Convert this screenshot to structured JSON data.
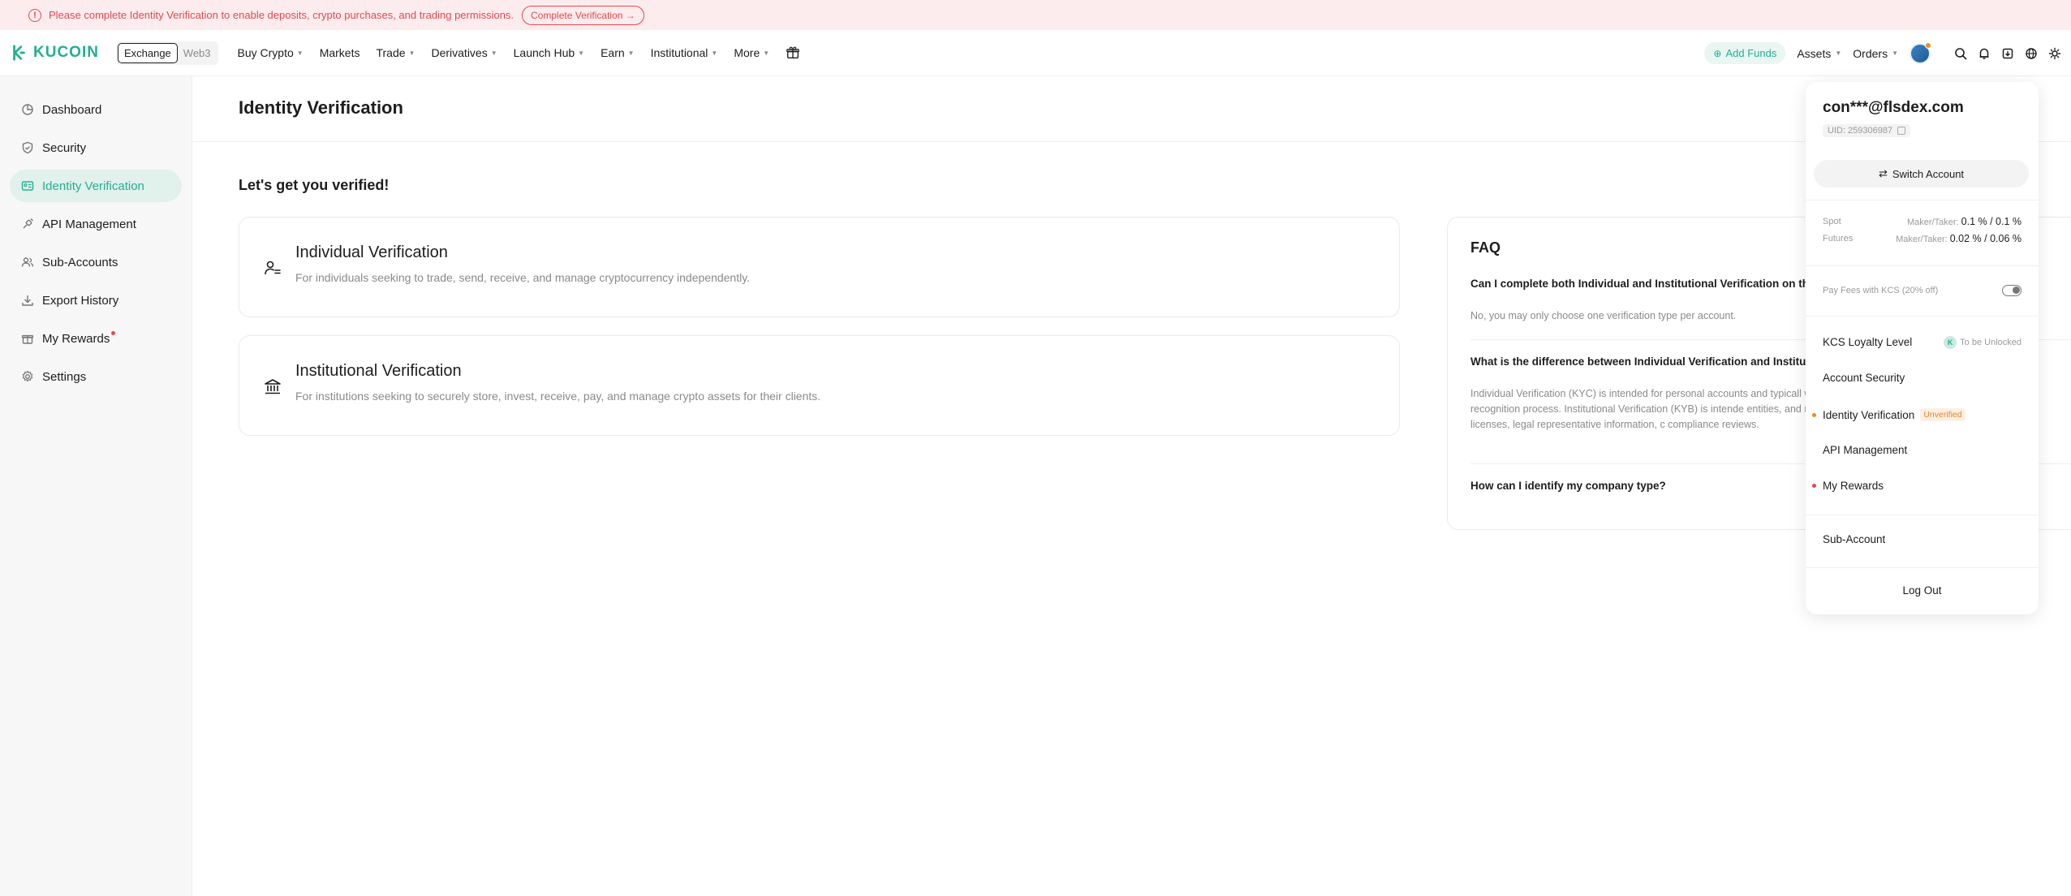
{
  "banner": {
    "icon": "warning-icon",
    "message": "Please complete Identity Verification to enable deposits, crypto purchases, and trading permissions.",
    "cta": "Complete Verification →"
  },
  "header": {
    "logo_text": "KUCOIN",
    "switcher": [
      "Exchange",
      "Web3"
    ],
    "nav": [
      {
        "label": "Buy Crypto",
        "caret": true
      },
      {
        "label": "Markets",
        "caret": false
      },
      {
        "label": "Trade",
        "caret": true
      },
      {
        "label": "Derivatives",
        "caret": true
      },
      {
        "label": "Launch Hub",
        "caret": true
      },
      {
        "label": "Earn",
        "caret": true
      },
      {
        "label": "Institutional",
        "caret": true
      },
      {
        "label": "More",
        "caret": true
      }
    ],
    "add_funds": "Add Funds",
    "assets": "Assets",
    "orders": "Orders"
  },
  "sidebar": {
    "items": [
      {
        "label": "Dashboard",
        "icon": "dashboard-icon",
        "active": false
      },
      {
        "label": "Security",
        "icon": "shield-icon",
        "active": false
      },
      {
        "label": "Identity Verification",
        "icon": "id-card-icon",
        "active": true
      },
      {
        "label": "API Management",
        "icon": "api-icon",
        "active": false
      },
      {
        "label": "Sub-Accounts",
        "icon": "users-icon",
        "active": false
      },
      {
        "label": "Export History",
        "icon": "download-icon",
        "active": false
      },
      {
        "label": "My Rewards",
        "icon": "gift-icon",
        "active": false,
        "dot": true
      },
      {
        "label": "Settings",
        "icon": "gear-icon",
        "active": false
      }
    ]
  },
  "main": {
    "title": "Identity Verification",
    "subtitle": "Let's get you verified!",
    "cards": [
      {
        "title": "Individual Verification",
        "desc": "For individuals seeking to trade, send, receive, and manage cryptocurrency independently."
      },
      {
        "title": "Institutional Verification",
        "desc": "For institutions seeking to securely store, invest, receive, pay, and manage crypto assets for their clients."
      }
    ],
    "faq": {
      "title": "FAQ",
      "q1": "Can I complete both Individual and Institutional Verification on the s",
      "a1": "No, you may only choose one verification type per account.",
      "q2": "What is the difference between Individual Verification and Institutio",
      "a2": "Individual Verification (KYC) is intended for personal accounts and typicall with a facial recognition process. Institutional Verification (KYB) is intende entities, and requires business licenses, legal representative information, c compliance reviews.",
      "q3": "How can I identify my company type?"
    }
  },
  "dropdown": {
    "email": "con***@flsdex.com",
    "uid": "UID: 259306987",
    "switch_account": "Switch Account",
    "fees": [
      {
        "label": "Spot",
        "prefix": "Maker/Taker:",
        "value": "0.1 % / 0.1 %"
      },
      {
        "label": "Futures",
        "prefix": "Maker/Taker:",
        "value": "0.02 % / 0.06 %"
      }
    ],
    "pay_fees": "Pay Fees with KCS (20% off)",
    "kcs_loyalty": "KCS Loyalty Level",
    "to_be_unlocked": "To be Unlocked",
    "account_security": "Account Security",
    "identity_verification": "Identity Verification",
    "unverified_badge": "Unverified",
    "api_management": "API Management",
    "my_rewards": "My Rewards",
    "sub_account": "Sub-Account",
    "log_out": "Log Out"
  },
  "colors": {
    "brand": "#23af91",
    "warning": "#e5484d",
    "orange": "#f08a24"
  }
}
